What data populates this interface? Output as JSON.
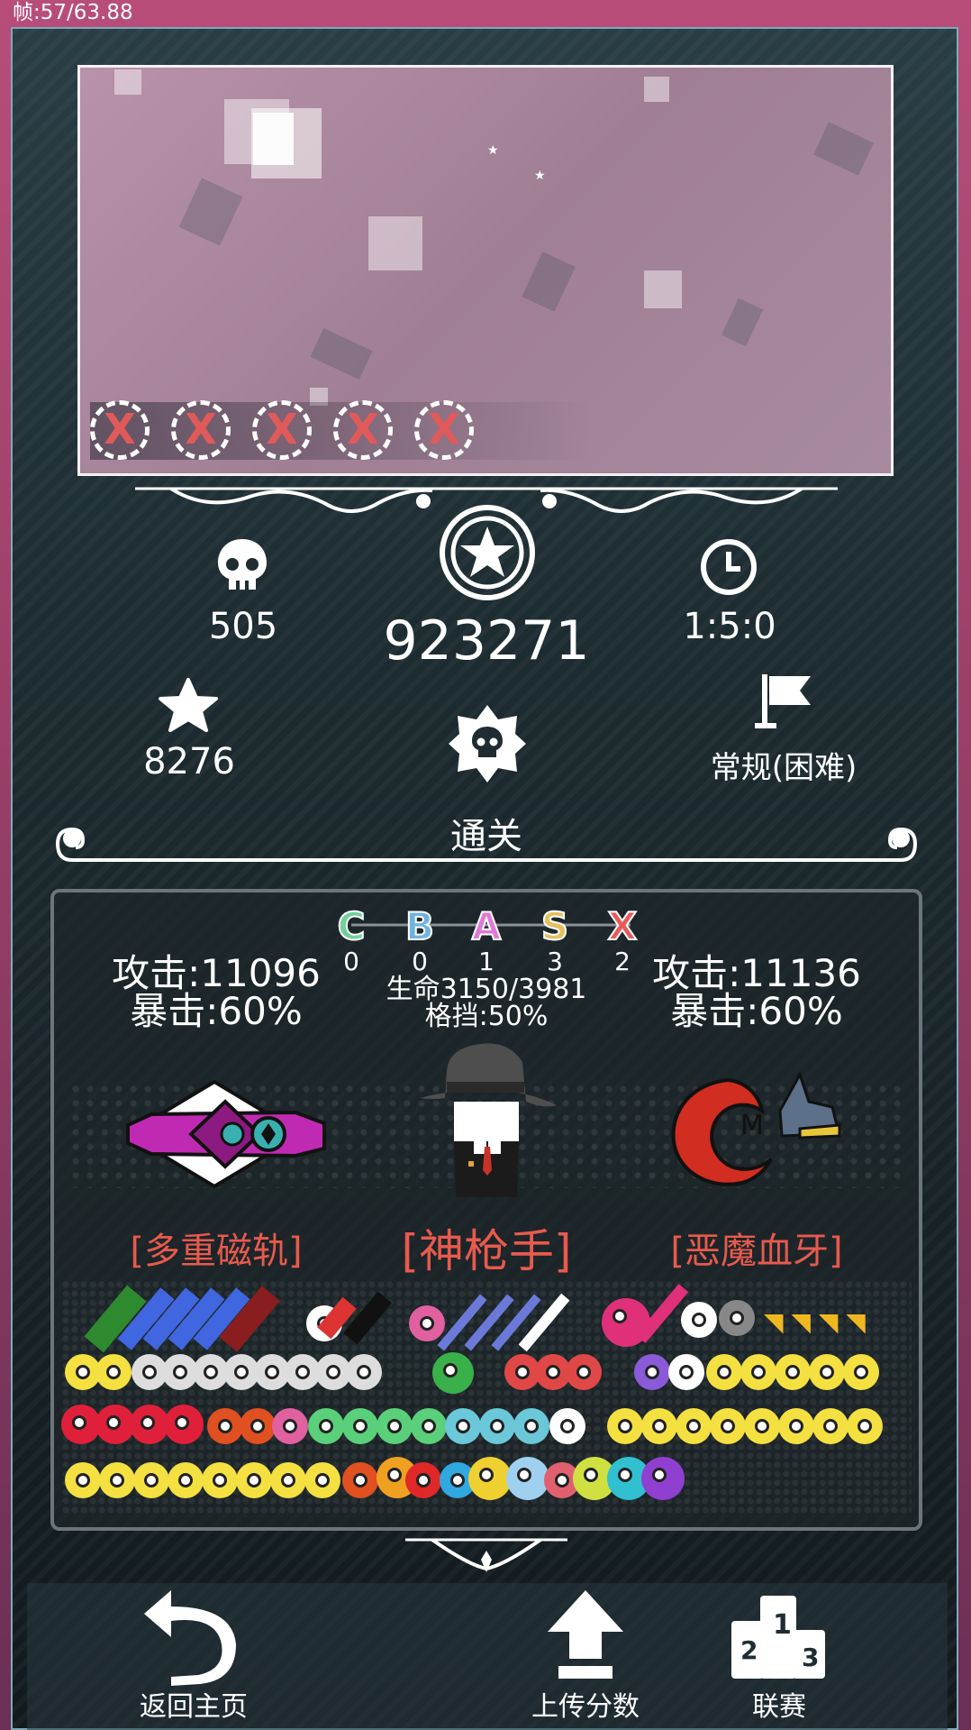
{
  "fps_text": "帧:57/63.88",
  "stats": {
    "kills": "505",
    "score": "923271",
    "time": "1:5:0",
    "stars": "8276",
    "mode": "常规(困难)",
    "result": "通关"
  },
  "grades": [
    {
      "letter": "C",
      "count": "0",
      "color": "#6fd29a"
    },
    {
      "letter": "B",
      "count": "0",
      "color": "#6fb4e0"
    },
    {
      "letter": "A",
      "count": "1",
      "color": "#e07ad6"
    },
    {
      "letter": "S",
      "count": "3",
      "color": "#e6c060"
    },
    {
      "letter": "X",
      "count": "2",
      "color": "#e85a5a"
    }
  ],
  "left_weapon": {
    "attack": "攻击:11096",
    "crit": "暴击:60%",
    "name": "[多重磁轨]"
  },
  "character": {
    "hp": "生命3150/3981",
    "block": "格挡:50%",
    "name": "[神枪手]"
  },
  "right_weapon": {
    "attack": "攻击:11136",
    "crit": "暴击:60%",
    "name": "[恶魔血牙]"
  },
  "lives_mark": "X",
  "buttons": {
    "home": "返回主页",
    "upload": "上传分数",
    "league": "联赛"
  },
  "colors": {
    "accent_red": "#e85a4e",
    "panel_border": "#6c767a",
    "frame_border": "#7eaab8"
  }
}
